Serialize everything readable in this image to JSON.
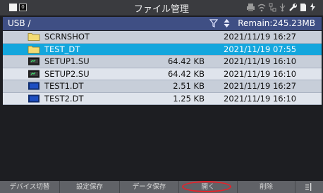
{
  "status_bar": {
    "title": "ファイル管理",
    "indicator_label": "0",
    "icons": [
      "printer-icon",
      "wifi-icon",
      "network-icon",
      "usb-icon",
      "wrench-icon",
      "sd-card-icon",
      "battery-icon"
    ]
  },
  "path_bar": {
    "path": "USB /",
    "remain": "Remain:245.23MB"
  },
  "files": [
    {
      "type": "folder",
      "name": "SCRNSHOT",
      "size": "",
      "date": "2021/11/19 16:27",
      "selected": false
    },
    {
      "type": "folder",
      "name": "TEST_DT",
      "size": "",
      "date": "2021/11/19 07:55",
      "selected": true
    },
    {
      "type": "setup",
      "name": "SETUP1.SU",
      "size": "64.42 KB",
      "date": "2021/11/19 16:10",
      "selected": false
    },
    {
      "type": "setup",
      "name": "SETUP2.SU",
      "size": "64.42 KB",
      "date": "2021/11/19 16:10",
      "selected": false
    },
    {
      "type": "data",
      "name": "TEST1.DT",
      "size": "2.51 KB",
      "date": "2021/11/19 16:27",
      "selected": false
    },
    {
      "type": "data",
      "name": "TEST2.DT",
      "size": "1.25 KB",
      "date": "2021/11/19 16:10",
      "selected": false
    }
  ],
  "function_keys": {
    "f1": "デバイス切替",
    "f2": "設定保存",
    "f3": "データ保存",
    "f4": "開く",
    "f5": "削除"
  },
  "colors": {
    "selection": "#13a6dd",
    "path_bar": "#3f4f84",
    "highlight_oval": "#e2242c"
  }
}
